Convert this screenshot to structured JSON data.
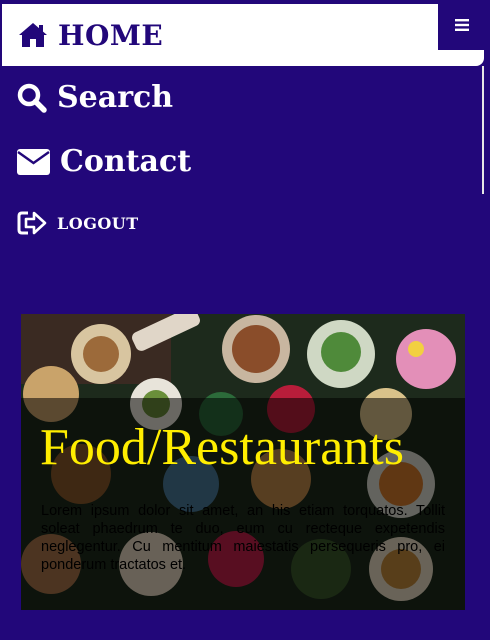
{
  "header": {
    "home_label": "HOME",
    "home_icon": "home-icon",
    "menu_icon": "hamburger-menu-icon"
  },
  "nav": {
    "search_label": "Search",
    "search_icon": "search-icon",
    "contact_label": "Contact",
    "contact_icon": "envelope-icon",
    "logout_label": "LOGOUT",
    "logout_icon": "sign-out-icon"
  },
  "hero": {
    "title": "Food/Restaurants",
    "text": "Lorem ipsum dolor sit amet, an his etiam torquatos. Tollit soleat phaedrum te duo, eum cu recteque expetendis neglegentur. Cu mentitum maiestatis persequeris pro, ei ponderum tractatos et."
  },
  "colors": {
    "background": "#22077a",
    "topbar": "#ffffff",
    "title": "#ffee00",
    "text": "#000000"
  }
}
